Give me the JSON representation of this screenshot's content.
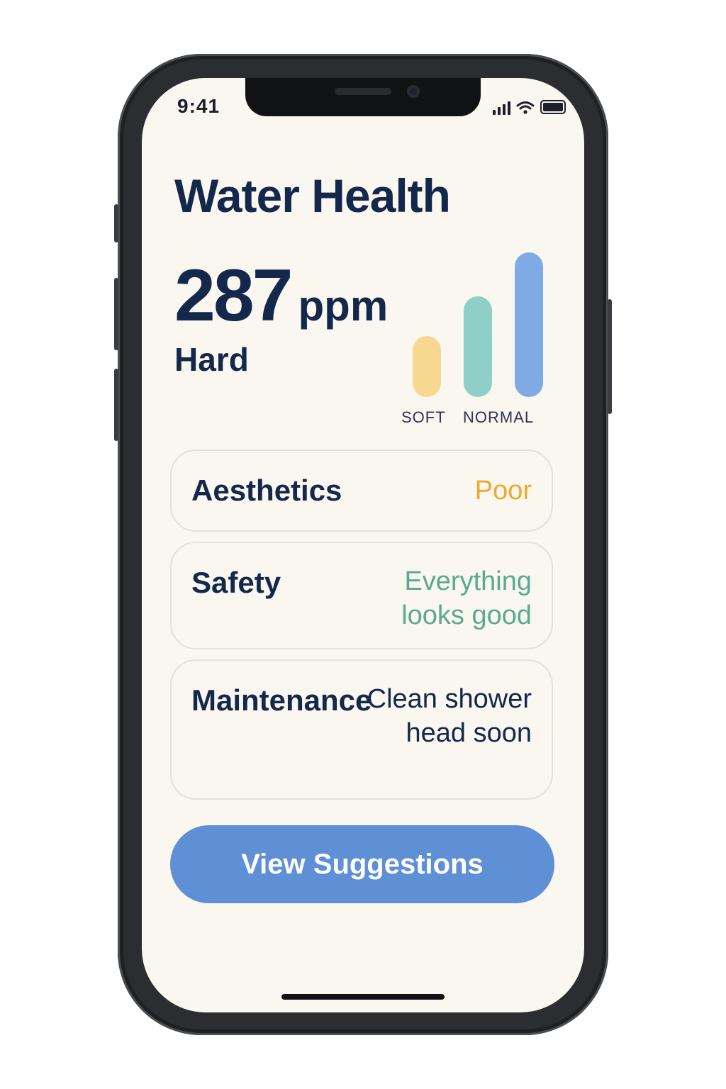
{
  "status_bar": {
    "time": "9:41"
  },
  "header": {
    "title": "Water Health"
  },
  "hardness": {
    "value": "287",
    "unit": "ppm",
    "category": "Hard",
    "scale_labels": [
      "SOFT",
      "NORMAL"
    ],
    "scale_colors": [
      "#f6d891",
      "#8fd0c6",
      "#80aae4"
    ]
  },
  "cards": [
    {
      "label": "Aesthetics",
      "value": "Poor",
      "value_color": "#eeaa2a"
    },
    {
      "label": "Safety",
      "value": "Everything looks good",
      "value_color": "#5aaa92"
    },
    {
      "label": "Maintenance",
      "value": "Clean shower head soon",
      "value_color": "#14284b"
    }
  ],
  "cta": {
    "label": "View Suggestions"
  },
  "colors": {
    "background": "#faf6f0",
    "text": "#14284b",
    "accent": "#5f8fd4"
  }
}
